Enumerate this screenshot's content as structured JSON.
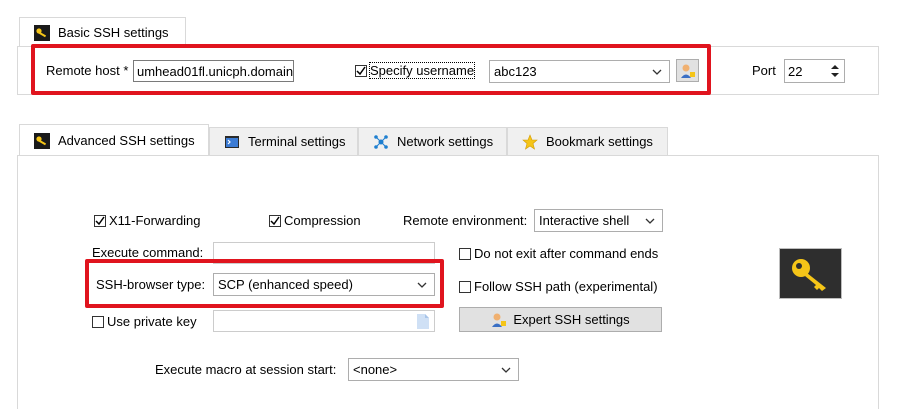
{
  "basic_tab": {
    "label": "Basic SSH settings"
  },
  "basic": {
    "remote_host_label": "Remote host *",
    "remote_host_value": "umhead01fl.unicph.domain",
    "specify_username_label": "Specify username",
    "specify_username_checked": true,
    "username_value": "abc123",
    "port_label": "Port",
    "port_value": "22"
  },
  "tabs": [
    {
      "label": "Advanced SSH settings",
      "icon": "key-icon",
      "active": true
    },
    {
      "label": "Terminal settings",
      "icon": "terminal-icon",
      "active": false
    },
    {
      "label": "Network settings",
      "icon": "network-icon",
      "active": false
    },
    {
      "label": "Bookmark settings",
      "icon": "star-icon",
      "active": false
    }
  ],
  "advanced": {
    "x11_label": "X11-Forwarding",
    "x11_checked": true,
    "compression_label": "Compression",
    "compression_checked": true,
    "remote_env_label": "Remote environment:",
    "remote_env_value": "Interactive shell",
    "execute_command_label": "Execute command:",
    "execute_command_value": "",
    "do_not_exit_label": "Do not exit after command ends",
    "do_not_exit_checked": false,
    "ssh_browser_label": "SSH-browser type:",
    "ssh_browser_value": "SCP (enhanced speed)",
    "follow_ssh_label": "Follow SSH path (experimental)",
    "follow_ssh_checked": false,
    "private_key_label": "Use private key",
    "private_key_checked": false,
    "expert_button_label": "Expert SSH settings",
    "macro_label": "Execute macro at session start:",
    "macro_value": "<none>"
  },
  "colors": {
    "highlight": "#e0141e",
    "key_tile": "#2e2e2e",
    "key_gold": "#f5c518"
  }
}
